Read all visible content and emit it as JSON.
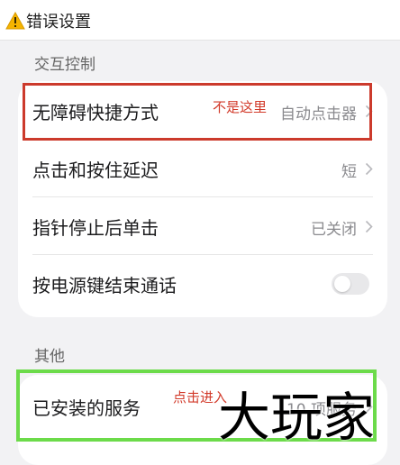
{
  "header": {
    "title": "错误设置",
    "icon": "warning-icon"
  },
  "section_interaction": {
    "label": "交互控制",
    "items": [
      {
        "label": "无障碍快捷方式",
        "value": "自动点击器",
        "icon": "chevron-right-icon"
      },
      {
        "label": "点击和按住延迟",
        "value": "短",
        "icon": "chevron-right-icon"
      },
      {
        "label": "指针停止后单击",
        "value": "已关闭",
        "icon": "chevron-right-icon"
      },
      {
        "label": "按电源键结束通话",
        "toggle": false
      }
    ]
  },
  "section_other": {
    "label": "其他",
    "items": [
      {
        "label": "已安装的服务",
        "value": "10 项服务",
        "icon": "chevron-right-icon"
      }
    ]
  },
  "annotations": {
    "not_here": "不是这里",
    "click_here": "点击进入",
    "red_color": "#cc3a2c",
    "green_color": "#6cdb4a"
  },
  "watermark": "大玩家"
}
